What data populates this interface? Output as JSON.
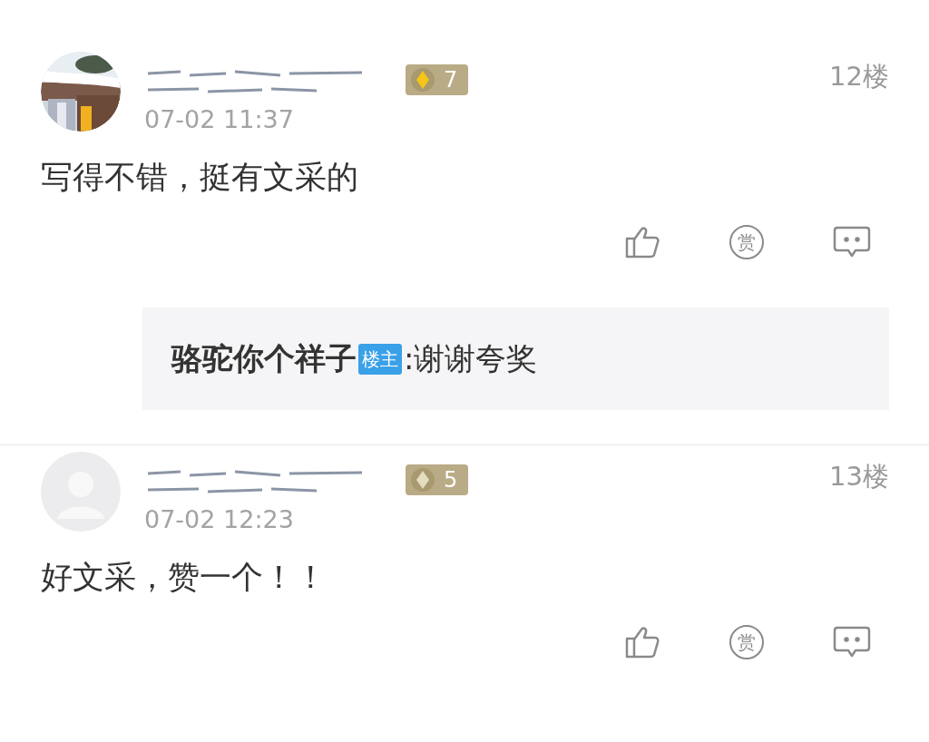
{
  "comments": [
    {
      "avatar": {
        "kind": "picture"
      },
      "badge": {
        "text": "7",
        "color": "#f5c518"
      },
      "floor": "12楼",
      "time": "07-02 11:37",
      "text": "写得不错，挺有文采的",
      "actions": [
        {
          "kind": "like"
        },
        {
          "kind": "reward",
          "text": "赏"
        },
        {
          "kind": "reply"
        }
      ],
      "replies": [
        {
          "author": "骆驼你个祥子",
          "tag": "楼主",
          "text": ":谢谢夸奖"
        }
      ]
    },
    {
      "avatar": {
        "kind": "default"
      },
      "badge": {
        "text": "5",
        "color": "#e6dcc0"
      },
      "floor": "13楼",
      "time": "07-02 12:23",
      "text": "好文采，赞一个！！",
      "actions": [
        {
          "kind": "like"
        },
        {
          "kind": "reward",
          "text": "赏"
        },
        {
          "kind": "reply"
        }
      ]
    }
  ]
}
